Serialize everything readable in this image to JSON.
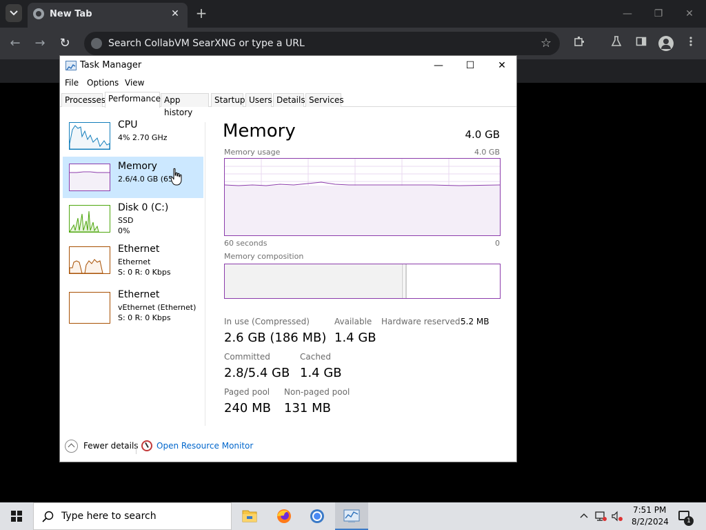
{
  "browser": {
    "tab_title": "New Tab",
    "tab_close": "✕",
    "new_tab": "+",
    "minimize": "—",
    "restore": "❐",
    "close": "✕",
    "address_placeholder": "Search CollabVM SearXNG or type a URL",
    "back": "←",
    "forward": "→",
    "reload": "↻",
    "bookmark": "☆"
  },
  "taskmgr": {
    "title": "Task Manager",
    "minimize": "—",
    "maximize": "☐",
    "close": "✕",
    "menu": [
      "File",
      "Options",
      "View"
    ],
    "tabs": [
      "Processes",
      "Performance",
      "App history",
      "Startup",
      "Users",
      "Details",
      "Services"
    ],
    "active_tab": "Performance",
    "left_items": [
      {
        "name": "CPU",
        "sub1": "4% 2.70 GHz",
        "sub2": "",
        "sub3": ""
      },
      {
        "name": "Memory",
        "sub1": "2.6/4.0 GB (65%)",
        "sub2": "",
        "sub3": ""
      },
      {
        "name": "Disk 0 (C:)",
        "sub1": "SSD",
        "sub2": "0%",
        "sub3": ""
      },
      {
        "name": "Ethernet",
        "sub1": "Ethernet",
        "sub2": "S: 0 R: 0 Kbps",
        "sub3": ""
      },
      {
        "name": "Ethernet",
        "sub1": "vEthernet (Ethernet)",
        "sub2": "S: 0 R: 0 Kbps",
        "sub3": ""
      }
    ],
    "memory": {
      "title": "Memory",
      "total": "4.0 GB",
      "usage_label": "Memory usage",
      "usage_max": "4.0 GB",
      "time_label": "60 seconds",
      "time_end": "0",
      "composition_label": "Memory composition",
      "in_use_label": "In use (Compressed)",
      "in_use_value": "2.6 GB (186 MB)",
      "available_label": "Available",
      "available_value": "1.4 GB",
      "hw_reserved_label": "Hardware reserved:",
      "hw_reserved_value": "5.2 MB",
      "committed_label": "Committed",
      "committed_value": "2.8/5.4 GB",
      "cached_label": "Cached",
      "cached_value": "1.4 GB",
      "paged_label": "Paged pool",
      "paged_value": "240 MB",
      "nonpaged_label": "Non-paged pool",
      "nonpaged_value": "131 MB",
      "usage_fraction": 0.65
    },
    "footer": {
      "fewer_details": "Fewer details",
      "open_resource_monitor": "Open Resource Monitor"
    }
  },
  "taskbar": {
    "search_placeholder": "Type here to search",
    "time": "7:51 PM",
    "date": "8/2/2024",
    "notification_count": "1"
  },
  "colors": {
    "memory_accent": "#8b3bab",
    "cpu_accent": "#117dbb",
    "disk_accent": "#4da60c",
    "ethernet_accent": "#a74f01",
    "link": "#0066cc"
  }
}
